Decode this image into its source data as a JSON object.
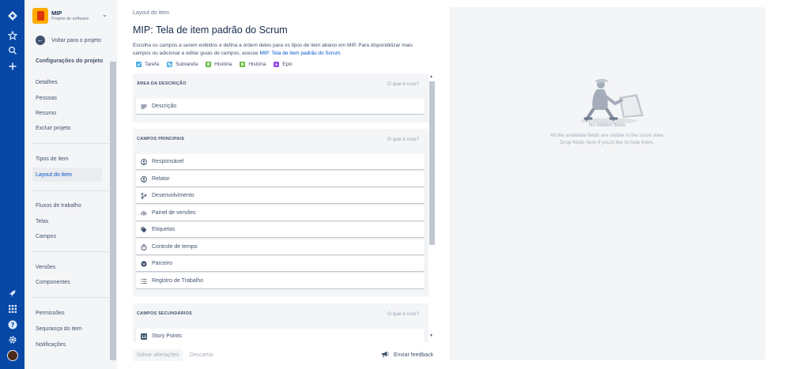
{
  "project": {
    "name": "MIP",
    "type": "Projeto de software"
  },
  "sidebar": {
    "back_label": "Voltar para o projeto",
    "section_title": "Configurações do projeto",
    "items": [
      {
        "label": "Detalhes"
      },
      {
        "label": "Pessoas"
      },
      {
        "label": "Resumo"
      },
      {
        "label": "Excluir projeto"
      },
      {
        "label": "Tipos de item"
      },
      {
        "label": "Layout do item"
      },
      {
        "label": "Fluxos de trabalho"
      },
      {
        "label": "Telas"
      },
      {
        "label": "Campos"
      },
      {
        "label": "Versões"
      },
      {
        "label": "Componentes"
      },
      {
        "label": "Permissões"
      },
      {
        "label": "Sequrança do item"
      },
      {
        "label": "Notificações"
      }
    ],
    "active_item": "Layout do item"
  },
  "main": {
    "breadcrumb": "Layout do item",
    "title": "MIP: Tela de item padrão do Scrum",
    "description_prefix": "Escolha os campos a serem exibidos e defina a ordem deles para os tipos de item abaixo em MIP. Para disponibilizar mais campos ou adicionar e editar guias de campos, acesse",
    "description_link": "MIP: Tela de item padrão do Scrum",
    "description_suffix": ".",
    "issue_types": [
      {
        "label": "Tarefa",
        "color": "#4bade8"
      },
      {
        "label": "Subtarefa",
        "color": "#4bade8"
      },
      {
        "label": "História",
        "color": "#63ba3c"
      },
      {
        "label": "História",
        "color": "#63ba3c"
      },
      {
        "label": "Epic",
        "color": "#904ee2"
      }
    ]
  },
  "groups": {
    "descricao": {
      "title": "ÁREA DA DESCRIÇÃO",
      "help": "O que é isso?",
      "fields": [
        {
          "label": "Descrição",
          "icon": "text-lines-icon"
        }
      ]
    },
    "principais": {
      "title": "CAMPOS PRINCIPAIS",
      "help": "O que é isso?",
      "fields": [
        {
          "label": "Responsável",
          "icon": "user-avatar-icon"
        },
        {
          "label": "Relator",
          "icon": "user-avatar-icon"
        },
        {
          "label": "Desenvolvimento",
          "icon": "branch-icon"
        },
        {
          "label": "Painel de versões",
          "icon": "cloud-upload-icon"
        },
        {
          "label": "Etiquetas",
          "icon": "tag-icon"
        },
        {
          "label": "Controle de tempo",
          "icon": "stopwatch-icon"
        },
        {
          "label": "Parceiro",
          "icon": "chevron-circle-icon"
        },
        {
          "label": "Registro de Trabalho",
          "icon": "list-icon"
        }
      ]
    },
    "secundarios": {
      "title": "CAMPOS SECUNDÁRIOS",
      "help": "O que é isso?",
      "fields": [
        {
          "label": "Story Points",
          "icon": "number-icon"
        }
      ]
    }
  },
  "footer": {
    "save_label": "Salvar alterações",
    "cancel_label": "Descartar",
    "feedback_label": "Enviar feedback"
  },
  "hidden_fields": {
    "title": "No hidden fields",
    "line1": "All the available fields are visible in the issue view.",
    "line2": "Drop fields here if you'd like to hide them."
  },
  "colors": {
    "nav": "#0747a6",
    "link": "#0052cc",
    "sidebar_bg": "#f4f5f7"
  }
}
